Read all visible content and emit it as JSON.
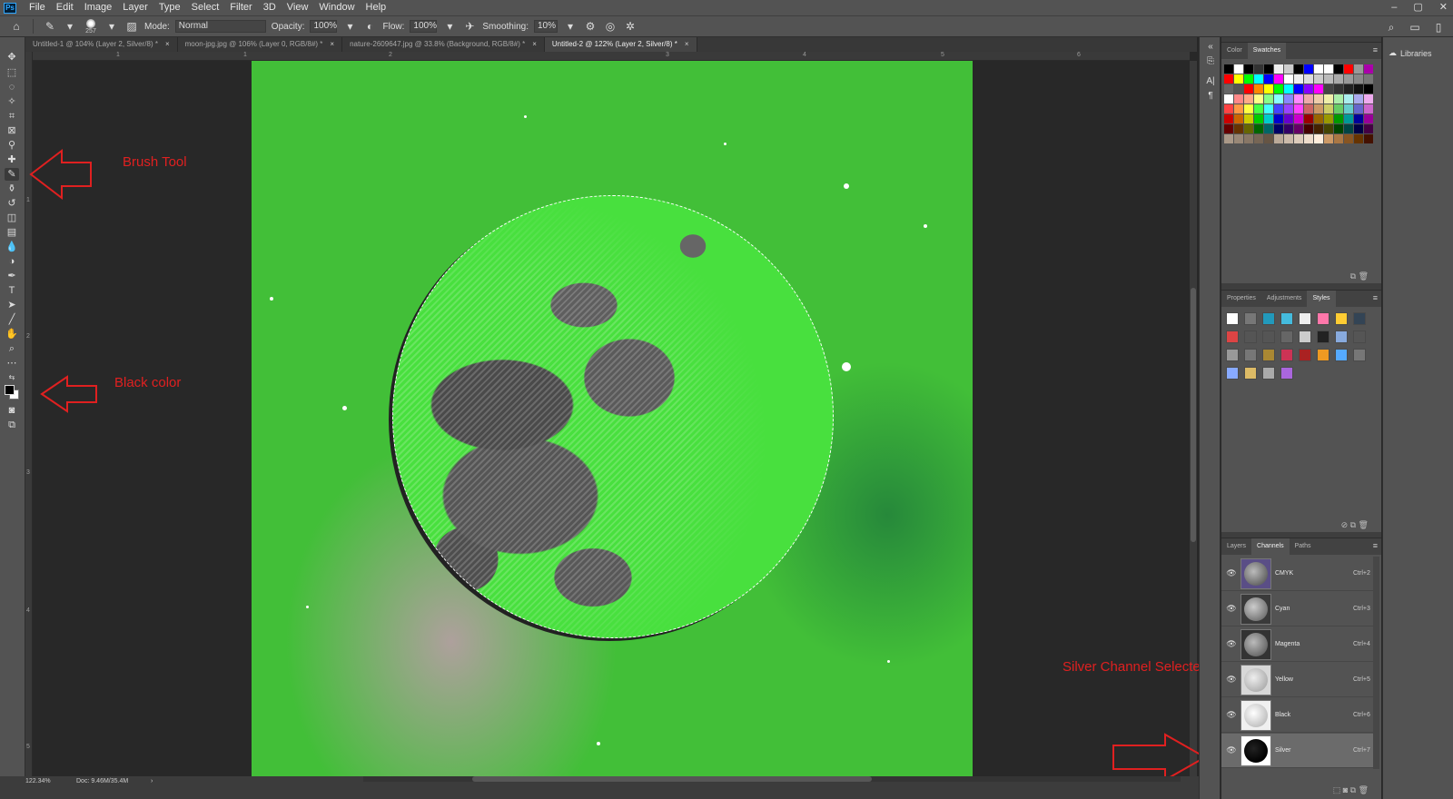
{
  "app": {
    "logo": "Ps"
  },
  "menu": [
    "File",
    "Edit",
    "Image",
    "Layer",
    "Type",
    "Select",
    "Filter",
    "3D",
    "View",
    "Window",
    "Help"
  ],
  "window_controls": [
    "–",
    "▢",
    "✕"
  ],
  "options": {
    "brush_size": "257",
    "mode_label": "Mode:",
    "mode_value": "Normal",
    "opacity_label": "Opacity:",
    "opacity_value": "100%",
    "flow_label": "Flow:",
    "flow_value": "100%",
    "smoothing_label": "Smoothing:",
    "smoothing_value": "10%"
  },
  "tabs": [
    {
      "label": "Untitled-1 @ 104% (Layer 2, Silver/8) *",
      "active": false
    },
    {
      "label": "moon-jpg.jpg @ 106% (Layer 0, RGB/8#) *",
      "active": false
    },
    {
      "label": "nature-2609647.jpg @ 33.8% (Background, RGB/8#) *",
      "active": false
    },
    {
      "label": "Untitled-2 @ 122% (Layer 2, Silver/8) *",
      "active": true
    }
  ],
  "ruler": {
    "top": [
      "1",
      "1",
      "2",
      "3",
      "4",
      "5",
      "6"
    ],
    "left": [
      "1",
      "2",
      "3",
      "4",
      "5"
    ]
  },
  "annotations": {
    "brush_tool": "Brush Tool",
    "black_color": "Black color",
    "silver_channel": "Silver Channel Selected"
  },
  "status": {
    "zoom": "122.34%",
    "doc": "Doc: 9.46M/35.4M"
  },
  "panels": {
    "swatches_tabs": [
      "Color",
      "Swatches"
    ],
    "swatches_active": "Swatches",
    "properties_tabs": [
      "Properties",
      "Adjustments",
      "Styles"
    ],
    "properties_active": "Styles",
    "channels_tabs": [
      "Layers",
      "Channels",
      "Paths"
    ],
    "channels_active": "Channels",
    "libraries_label": "Libraries"
  },
  "channels": [
    {
      "name": "CMYK",
      "shortcut": "Ctrl+2",
      "selected": false
    },
    {
      "name": "Cyan",
      "shortcut": "Ctrl+3",
      "selected": false
    },
    {
      "name": "Magenta",
      "shortcut": "Ctrl+4",
      "selected": false
    },
    {
      "name": "Yellow",
      "shortcut": "Ctrl+5",
      "selected": false
    },
    {
      "name": "Black",
      "shortcut": "Ctrl+6",
      "selected": false
    },
    {
      "name": "Silver",
      "shortcut": "Ctrl+7",
      "selected": true
    }
  ],
  "colors": {
    "accent_annotation": "#e02020",
    "canvas_green": "#42bf38",
    "moon_green": "#48e03e",
    "foreground": "#000000",
    "background": "#ffffff"
  }
}
